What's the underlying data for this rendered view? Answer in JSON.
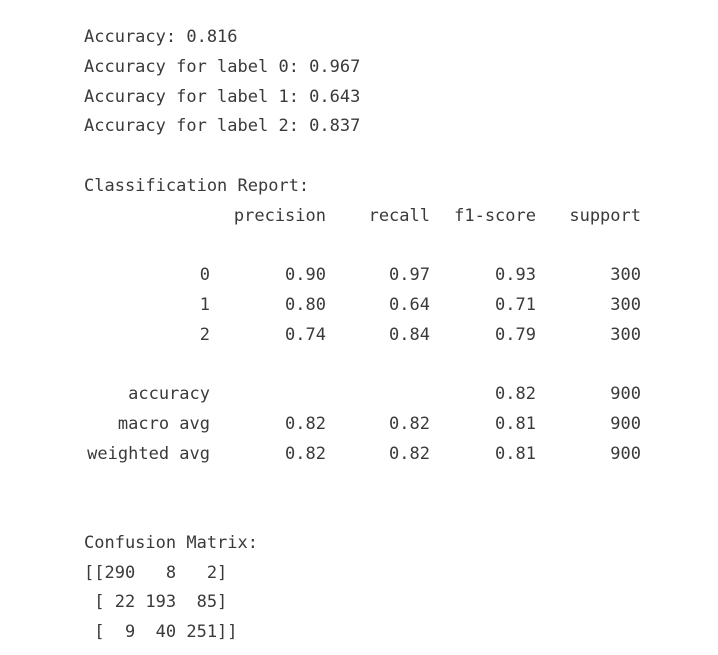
{
  "metrics": {
    "accuracy": "Accuracy: 0.816",
    "label0": "Accuracy for label 0: 0.967",
    "label1": "Accuracy for label 1: 0.643",
    "label2": "Accuracy for label 2: 0.837"
  },
  "report": {
    "title": "Classification Report:",
    "headers": [
      "precision",
      "recall",
      "f1-score",
      "support"
    ],
    "class_rows": [
      {
        "label": "0",
        "precision": "0.90",
        "recall": "0.97",
        "f1": "0.93",
        "support": "300"
      },
      {
        "label": "1",
        "precision": "0.80",
        "recall": "0.64",
        "f1": "0.71",
        "support": "300"
      },
      {
        "label": "2",
        "precision": "0.74",
        "recall": "0.84",
        "f1": "0.79",
        "support": "300"
      }
    ],
    "summary_rows": [
      {
        "label": "accuracy",
        "precision": "",
        "recall": "",
        "f1": "0.82",
        "support": "900"
      },
      {
        "label": "macro avg",
        "precision": "0.82",
        "recall": "0.82",
        "f1": "0.81",
        "support": "900"
      },
      {
        "label": "weighted avg",
        "precision": "0.82",
        "recall": "0.82",
        "f1": "0.81",
        "support": "900"
      }
    ]
  },
  "confusion": {
    "title": "Confusion Matrix:",
    "rows": [
      "[[290   8   2]",
      " [ 22 193  85]",
      " [  9  40 251]]"
    ]
  }
}
